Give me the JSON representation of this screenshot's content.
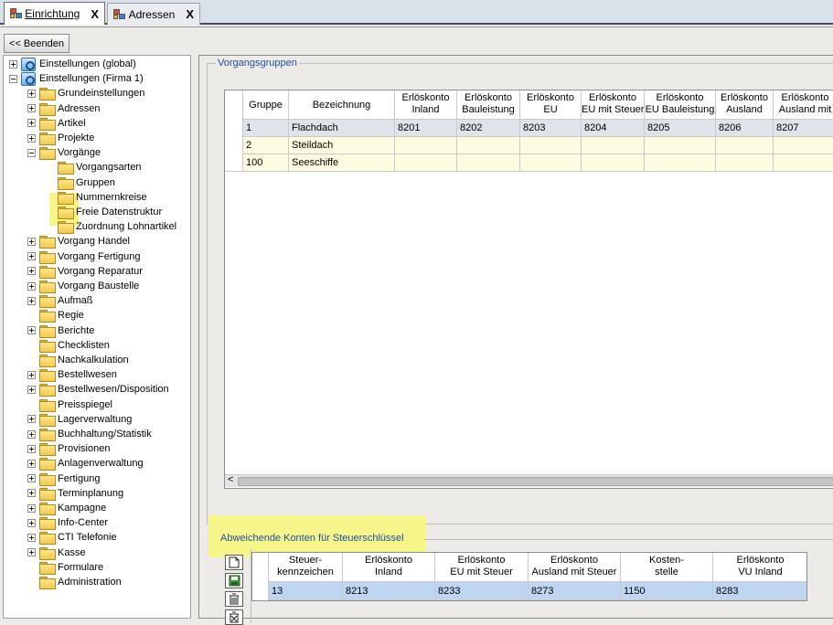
{
  "tabs": [
    {
      "label": "Einrichtung",
      "active": true,
      "close": "X"
    },
    {
      "label": "Adressen",
      "active": false,
      "close": "X"
    }
  ],
  "toolbar": {
    "back_label": "<< Beenden"
  },
  "tree": [
    {
      "label": "Einstellungen (global)",
      "level": 0,
      "expander": "plus",
      "icon": "settings-icon"
    },
    {
      "label": "Einstellungen (Firma 1)",
      "level": 0,
      "expander": "minus",
      "icon": "settings-icon"
    },
    {
      "label": "Grundeinstellungen",
      "level": 1,
      "expander": "plus",
      "icon": "folder-icon"
    },
    {
      "label": "Adressen",
      "level": 1,
      "expander": "plus",
      "icon": "folder-icon"
    },
    {
      "label": "Artikel",
      "level": 1,
      "expander": "plus",
      "icon": "folder-icon"
    },
    {
      "label": "Projekte",
      "level": 1,
      "expander": "plus",
      "icon": "folder-icon"
    },
    {
      "label": "Vorgänge",
      "level": 1,
      "expander": "minus",
      "icon": "folder-icon"
    },
    {
      "label": "Vorgangsarten",
      "level": 2,
      "expander": "none",
      "icon": "folder-icon"
    },
    {
      "label": "Gruppen",
      "level": 2,
      "expander": "none",
      "icon": "folder-icon",
      "selected": true
    },
    {
      "label": "Nummernkreise",
      "level": 2,
      "expander": "none",
      "icon": "folder-icon"
    },
    {
      "label": "Freie Datenstruktur",
      "level": 2,
      "expander": "none",
      "icon": "folder-icon"
    },
    {
      "label": "Zuordnung Lohnartikel",
      "level": 2,
      "expander": "none",
      "icon": "folder-icon"
    },
    {
      "label": "Vorgang Handel",
      "level": 1,
      "expander": "plus",
      "icon": "folder-icon"
    },
    {
      "label": "Vorgang Fertigung",
      "level": 1,
      "expander": "plus",
      "icon": "folder-icon"
    },
    {
      "label": "Vorgang Reparatur",
      "level": 1,
      "expander": "plus",
      "icon": "folder-icon"
    },
    {
      "label": "Vorgang Baustelle",
      "level": 1,
      "expander": "plus",
      "icon": "folder-icon"
    },
    {
      "label": "Aufmaß",
      "level": 1,
      "expander": "plus",
      "icon": "folder-icon"
    },
    {
      "label": "Regie",
      "level": 1,
      "expander": "none",
      "icon": "folder-icon"
    },
    {
      "label": "Berichte",
      "level": 1,
      "expander": "plus",
      "icon": "folder-icon"
    },
    {
      "label": "Checklisten",
      "level": 1,
      "expander": "none",
      "icon": "folder-icon"
    },
    {
      "label": "Nachkalkulation",
      "level": 1,
      "expander": "none",
      "icon": "folder-icon"
    },
    {
      "label": "Bestellwesen",
      "level": 1,
      "expander": "plus",
      "icon": "folder-icon"
    },
    {
      "label": "Bestellwesen/Disposition",
      "level": 1,
      "expander": "plus",
      "icon": "folder-icon"
    },
    {
      "label": "Preisspiegel",
      "level": 1,
      "expander": "none",
      "icon": "folder-icon"
    },
    {
      "label": "Lagerverwaltung",
      "level": 1,
      "expander": "plus",
      "icon": "folder-icon"
    },
    {
      "label": "Buchhaltung/Statistik",
      "level": 1,
      "expander": "plus",
      "icon": "folder-icon"
    },
    {
      "label": "Provisionen",
      "level": 1,
      "expander": "plus",
      "icon": "folder-icon"
    },
    {
      "label": "Anlagenverwaltung",
      "level": 1,
      "expander": "plus",
      "icon": "folder-icon"
    },
    {
      "label": "Fertigung",
      "level": 1,
      "expander": "plus",
      "icon": "folder-icon"
    },
    {
      "label": "Terminplanung",
      "level": 1,
      "expander": "plus",
      "icon": "folder-icon"
    },
    {
      "label": "Kampagne",
      "level": 1,
      "expander": "plus",
      "icon": "folder-icon"
    },
    {
      "label": "Info-Center",
      "level": 1,
      "expander": "plus",
      "icon": "folder-icon"
    },
    {
      "label": "CTI Telefonie",
      "level": 1,
      "expander": "plus",
      "icon": "folder-icon"
    },
    {
      "label": "Kasse",
      "level": 1,
      "expander": "plus",
      "icon": "folder-icon"
    },
    {
      "label": "Formulare",
      "level": 1,
      "expander": "none",
      "icon": "folder-icon"
    },
    {
      "label": "Administration",
      "level": 1,
      "expander": "none",
      "icon": "folder-icon"
    }
  ],
  "vorgangsgruppen": {
    "title": "Vorgangsgruppen",
    "columns": [
      {
        "line1": "Gruppe",
        "line2": ""
      },
      {
        "line1": "Bezeichnung",
        "line2": ""
      },
      {
        "line1": "Erlöskonto",
        "line2": "Inland"
      },
      {
        "line1": "Erlöskonto",
        "line2": "Bauleistung"
      },
      {
        "line1": "Erlöskonto",
        "line2": "EU"
      },
      {
        "line1": "Erlöskonto",
        "line2": "EU mit Steuer"
      },
      {
        "line1": "Erlöskonto",
        "line2": "EU Bauleistung"
      },
      {
        "line1": "Erlöskonto",
        "line2": "Ausland"
      },
      {
        "line1": "Erlöskonto",
        "line2": "Ausland mit"
      }
    ],
    "rows": [
      [
        "1",
        "Flachdach",
        "8201",
        "8202",
        "8203",
        "8204",
        "8205",
        "8206",
        "8207"
      ],
      [
        "2",
        "Steildach",
        "",
        "",
        "",
        "",
        "",
        "",
        ""
      ],
      [
        "100",
        "Seeschiffe",
        "",
        "",
        "",
        "",
        "",
        "",
        ""
      ]
    ],
    "scroll_arrow": "<"
  },
  "konten": {
    "title": "Abweichende Konten für Steuerschlüssel",
    "columns": [
      {
        "line1": "Steuer-",
        "line2": "kennzeichen"
      },
      {
        "line1": "Erlöskonto",
        "line2": "Inland"
      },
      {
        "line1": "Erlöskonto",
        "line2": "EU mit Steuer"
      },
      {
        "line1": "Erlöskonto",
        "line2": "Ausland mit Steuer"
      },
      {
        "line1": "Kosten-",
        "line2": "stelle"
      },
      {
        "line1": "Erlöskonto",
        "line2": "VU Inland"
      }
    ],
    "rows": [
      [
        "13",
        "8213",
        "8233",
        "8273",
        "1150",
        "8283"
      ]
    ],
    "buttons": [
      "new-icon",
      "save-icon",
      "delete-icon",
      "delete-all-icon"
    ]
  },
  "colors": {
    "highlight": "#f6f58a",
    "group_title": "#1f4fa0",
    "selected_row": "#bfd6f3"
  }
}
